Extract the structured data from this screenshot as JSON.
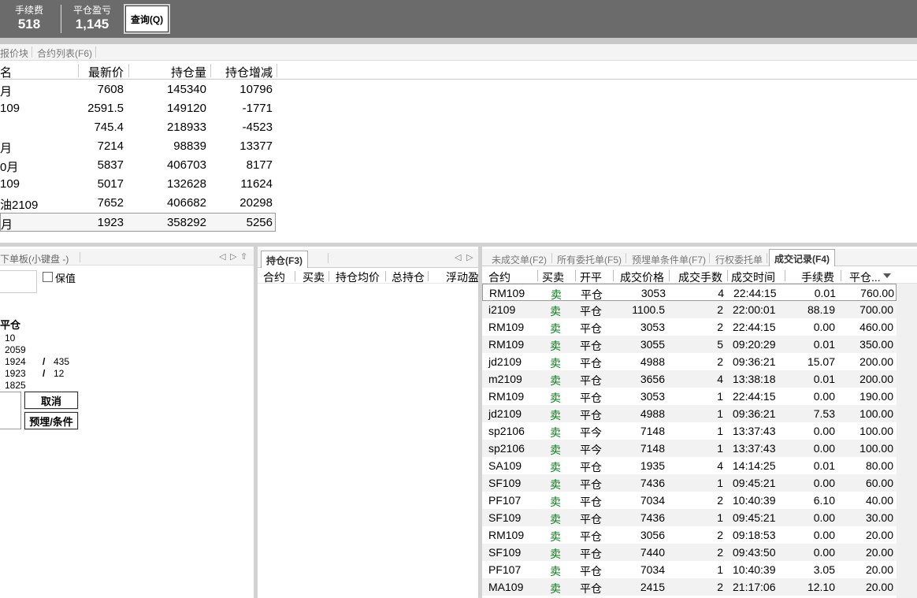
{
  "topbar": {
    "fee_label": "手续费",
    "fee_value": "518",
    "pnl_label": "平仓盈亏",
    "pnl_value": "1,145",
    "query_label": "查询(Q)"
  },
  "quote_tabs": [
    "报价块",
    "合约列表(F6)"
  ],
  "quote_table": {
    "headers": [
      "名",
      "最新价",
      "持仓量",
      "持仓增减"
    ],
    "rows": [
      [
        "月",
        "7608",
        "145340",
        "10796"
      ],
      [
        "109",
        "2591.5",
        "149120",
        "-1771"
      ],
      [
        "",
        "745.4",
        "218933",
        "-4523"
      ],
      [
        "月",
        "7214",
        "98839",
        "13377"
      ],
      [
        "0月",
        "5837",
        "406703",
        "8177"
      ],
      [
        "109",
        "5017",
        "132628",
        "11624"
      ],
      [
        "油2109",
        "7652",
        "406682",
        "20298"
      ],
      [
        "月",
        "1923",
        "358292",
        "5256"
      ]
    ]
  },
  "order_panel": {
    "tab_label": "下单板(小键盘 -)",
    "nav_prev": "◁",
    "nav_next": "▷",
    "nav_up": "⇧",
    "hold_label": "保值",
    "close_title": "平仓",
    "quotes": [
      {
        "price": "10",
        "qty": ""
      },
      {
        "price": "2059",
        "qty": ""
      },
      {
        "price": "1924",
        "qty": "435"
      },
      {
        "price": "1923",
        "qty": "12"
      },
      {
        "price": "1825",
        "qty": ""
      }
    ],
    "slash": "/",
    "cancel_label": "取消",
    "preorder_label": "预埋/条件"
  },
  "positions_panel": {
    "tab_label": "持仓(F3)",
    "nav_prev": "◁",
    "nav_next": "▷",
    "headers": [
      "合约",
      "买卖",
      "持仓均价",
      "总持仓",
      "浮动盈"
    ]
  },
  "trades_panel": {
    "tabs": [
      "未成交单(F2)",
      "所有委托单(F5)",
      "预埋单条件单(F7)",
      "行权委托单",
      "成交记录(F4)"
    ],
    "active_tab": "成交记录(F4)",
    "headers": [
      "合约",
      "买卖",
      "开平",
      "成交价格",
      "成交手数",
      "成交时间",
      "手续费",
      "平仓..."
    ],
    "sort_icon": "sort-down-icon",
    "rows": [
      [
        "RM109",
        "卖",
        "平仓",
        "3053",
        "4",
        "22:44:15",
        "0.01",
        "760.00"
      ],
      [
        "i2109",
        "卖",
        "平仓",
        "1100.5",
        "2",
        "22:00:01",
        "88.19",
        "700.00"
      ],
      [
        "RM109",
        "卖",
        "平仓",
        "3053",
        "2",
        "22:44:15",
        "0.00",
        "460.00"
      ],
      [
        "RM109",
        "卖",
        "平仓",
        "3055",
        "5",
        "09:20:29",
        "0.01",
        "350.00"
      ],
      [
        "jd2109",
        "卖",
        "平仓",
        "4988",
        "2",
        "09:36:21",
        "15.07",
        "200.00"
      ],
      [
        "m2109",
        "卖",
        "平仓",
        "3656",
        "4",
        "13:38:18",
        "0.01",
        "200.00"
      ],
      [
        "RM109",
        "卖",
        "平仓",
        "3053",
        "1",
        "22:44:15",
        "0.00",
        "190.00"
      ],
      [
        "jd2109",
        "卖",
        "平仓",
        "4988",
        "1",
        "09:36:21",
        "7.53",
        "100.00"
      ],
      [
        "sp2106",
        "卖",
        "平今",
        "7148",
        "1",
        "13:37:43",
        "0.00",
        "100.00"
      ],
      [
        "sp2106",
        "卖",
        "平今",
        "7148",
        "1",
        "13:37:43",
        "0.00",
        "100.00"
      ],
      [
        "SA109",
        "卖",
        "平仓",
        "1935",
        "4",
        "14:14:25",
        "0.01",
        "80.00"
      ],
      [
        "SF109",
        "卖",
        "平仓",
        "7436",
        "1",
        "09:45:21",
        "0.00",
        "60.00"
      ],
      [
        "PF107",
        "卖",
        "平仓",
        "7034",
        "2",
        "10:40:39",
        "6.10",
        "40.00"
      ],
      [
        "SF109",
        "卖",
        "平仓",
        "7436",
        "1",
        "09:45:21",
        "0.00",
        "30.00"
      ],
      [
        "RM109",
        "卖",
        "平仓",
        "3056",
        "2",
        "09:18:53",
        "0.00",
        "20.00"
      ],
      [
        "SF109",
        "卖",
        "平仓",
        "7440",
        "2",
        "09:43:50",
        "0.00",
        "20.00"
      ],
      [
        "PF107",
        "卖",
        "平仓",
        "7034",
        "1",
        "10:40:39",
        "3.05",
        "20.00"
      ],
      [
        "MA109",
        "卖",
        "平仓",
        "2415",
        "2",
        "21:17:06",
        "12.10",
        "20.00"
      ]
    ]
  },
  "colors": {
    "topbar": "#6b6b6b",
    "sell": "#0a7a1a",
    "divider": "#d2d2d2"
  }
}
